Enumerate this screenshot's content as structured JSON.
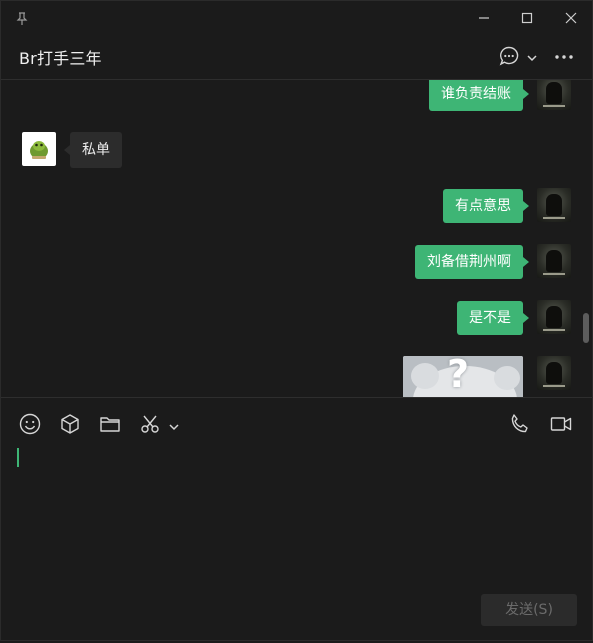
{
  "header": {
    "title": "Br打手三年"
  },
  "messages": [
    {
      "side": "right",
      "text": "谁负责结账"
    },
    {
      "side": "left",
      "text": "私单"
    },
    {
      "side": "right",
      "text": "有点意思"
    },
    {
      "side": "right",
      "text": "刘备借荆州啊"
    },
    {
      "side": "right",
      "text": "是不是"
    },
    {
      "side": "right",
      "type": "sticker",
      "glyph": "?"
    }
  ],
  "composer": {
    "value": "",
    "send_label": "发送(S)"
  },
  "icons": {
    "window": [
      "pin-icon",
      "minimize-icon",
      "maximize-icon",
      "close-icon"
    ],
    "header": [
      "chat-info-icon",
      "chevron-down-icon",
      "more-icon"
    ],
    "toolbar": [
      "emoji-icon",
      "box-icon",
      "folder-icon",
      "scissors-icon",
      "chevron-down-icon",
      "phone-icon",
      "video-icon"
    ]
  },
  "colors": {
    "accent": "#3eb575",
    "background": "#1b1b1b",
    "bubble_left": "#2c2c2c",
    "send_disabled_text": "#6b6b6b"
  }
}
